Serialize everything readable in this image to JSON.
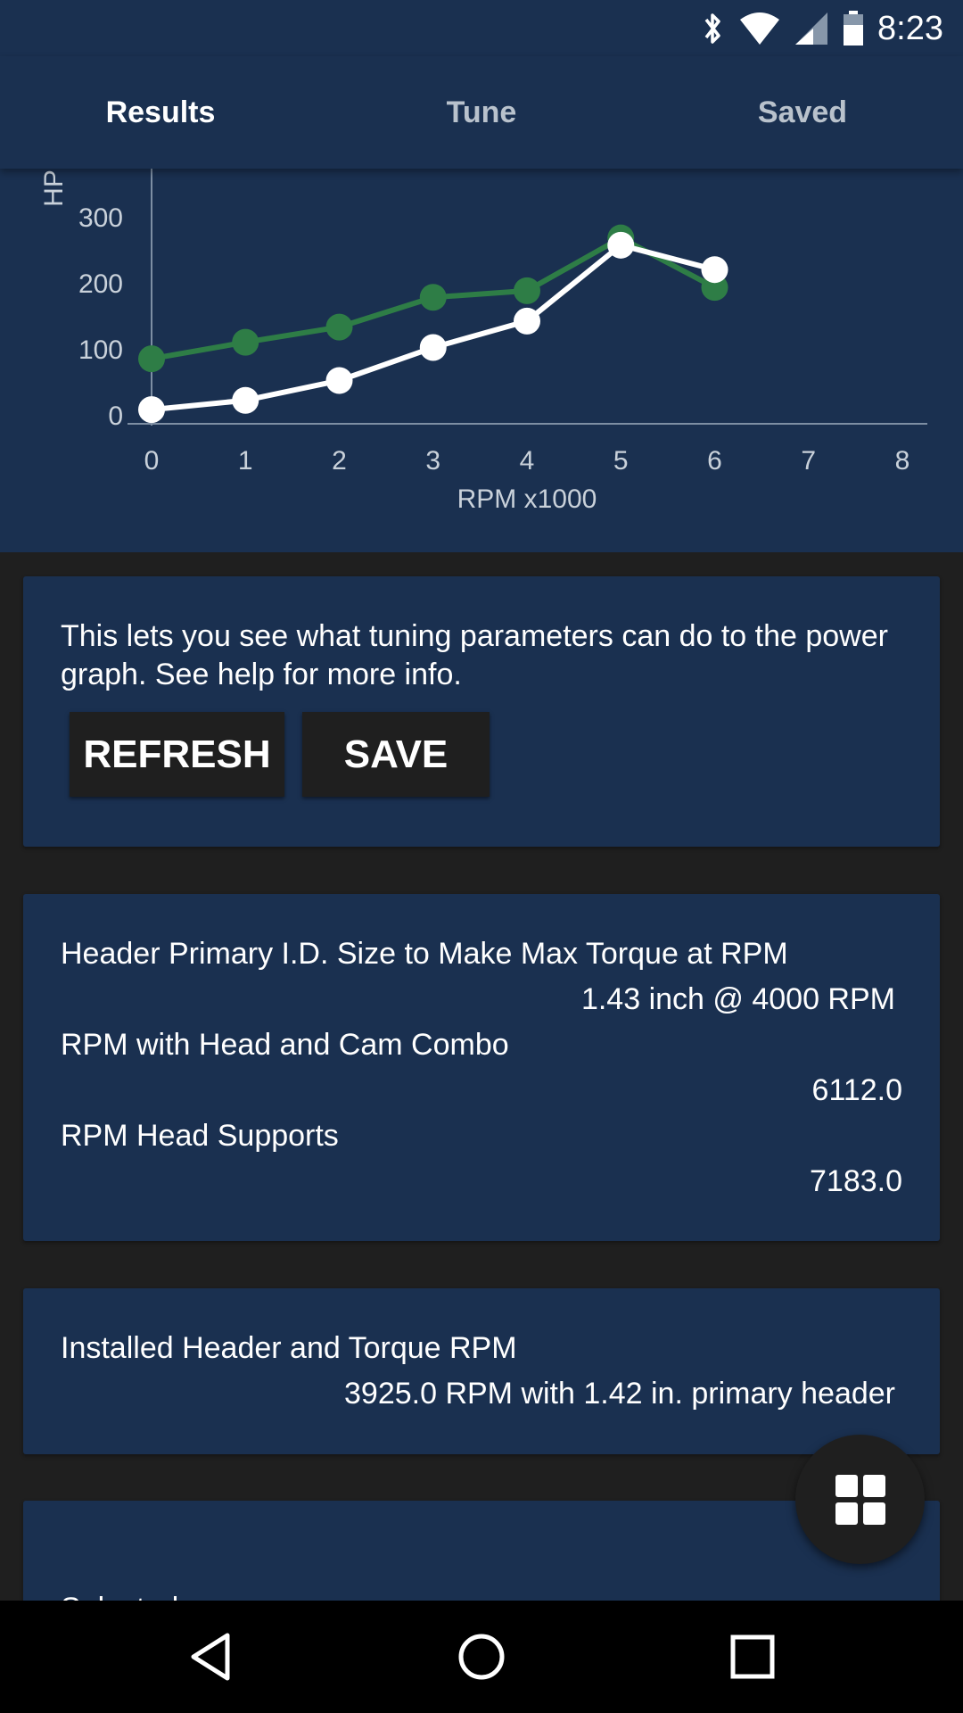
{
  "status_bar": {
    "time": "8:23"
  },
  "tabs": [
    {
      "label": "Results",
      "active": true
    },
    {
      "label": "Tune",
      "active": false
    },
    {
      "label": "Saved",
      "active": false
    }
  ],
  "chart_data": {
    "type": "line",
    "xlabel": "RPM x1000",
    "ylabel": "HP",
    "x_ticks": [
      0,
      1,
      2,
      3,
      4,
      5,
      6,
      7,
      8
    ],
    "y_ticks": [
      0,
      100,
      200,
      300
    ],
    "xlim": [
      0,
      8
    ],
    "ylim": [
      0,
      300
    ],
    "series": [
      {
        "color": "#2e7d46",
        "x": [
          0,
          1,
          2,
          3,
          4,
          5,
          6
        ],
        "values": [
          85,
          110,
          133,
          178,
          188,
          268,
          193
        ]
      },
      {
        "color": "#ffffff",
        "x": [
          0,
          1,
          2,
          3,
          4,
          5,
          6
        ],
        "values": [
          8,
          22,
          52,
          102,
          142,
          257,
          220
        ]
      }
    ]
  },
  "info_card": {
    "description": "This lets you see what tuning parameters can do to the power graph. See help for more info.",
    "refresh_label": "REFRESH",
    "save_label": "SAVE"
  },
  "header_card": {
    "primary_label": "Header Primary I.D. Size to Make Max Torque at RPM",
    "primary_value": "1.43 inch @ 4000 RPM",
    "combo_label": "RPM with Head and Cam Combo",
    "combo_value": "6112.0",
    "head_label": "RPM Head Supports",
    "head_value": "7183.0"
  },
  "installed_card": {
    "label": "Installed Header and Torque RPM",
    "value": "3925.0 RPM with 1.42 in. primary header"
  },
  "partial_card": {
    "label": "Selected"
  },
  "icons": {
    "fab": "grid-icon",
    "nav_back": "back-triangle-icon",
    "nav_home": "home-circle-icon",
    "nav_recents": "recents-square-icon"
  }
}
